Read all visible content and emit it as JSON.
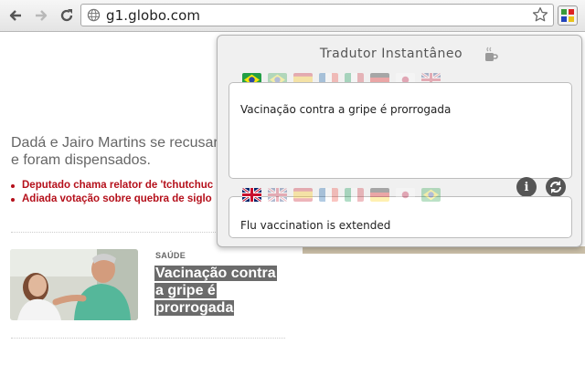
{
  "browser": {
    "url": "g1.globo.com",
    "icons": [
      "back-arrow-icon",
      "forward-arrow-icon",
      "reload-icon",
      "globe-icon",
      "bookmark-star-icon",
      "translator-extension-icon"
    ]
  },
  "page": {
    "lead_line1": "Dadá e Jairo Martins se recusara",
    "lead_line2": "e foram dispensados.",
    "bullets": [
      "Deputado chama relator de 'tchutchuc",
      "Adiada votação sobre quebra de siglo"
    ],
    "story": {
      "section": "SAÚDE",
      "headline": "Vacinação contra a gripe é prorrogada"
    },
    "colors": {
      "bullet_red": "#b5101b",
      "headline_bg": "#6b6b6b"
    }
  },
  "popup": {
    "title": "Tradutor Instantâneo",
    "source_flags": [
      {
        "name": "brazil-flag-icon",
        "active": true
      },
      {
        "name": "brazil-flag-icon",
        "active": false
      },
      {
        "name": "spain-flag-icon",
        "active": false
      },
      {
        "name": "france-flag-icon",
        "active": false
      },
      {
        "name": "italy-flag-icon",
        "active": false
      },
      {
        "name": "germany-flag-icon",
        "active": false
      },
      {
        "name": "japan-flag-icon",
        "active": false
      },
      {
        "name": "uk-flag-icon",
        "active": false
      }
    ],
    "target_flags": [
      {
        "name": "uk-flag-icon",
        "active": true
      },
      {
        "name": "uk-flag-icon",
        "active": false
      },
      {
        "name": "spain-flag-icon",
        "active": false
      },
      {
        "name": "france-flag-icon",
        "active": false
      },
      {
        "name": "italy-flag-icon",
        "active": false
      },
      {
        "name": "germany-flag-icon",
        "active": false
      },
      {
        "name": "japan-flag-icon",
        "active": false
      },
      {
        "name": "brazil-flag-icon",
        "active": false
      }
    ],
    "source_text": "Vacinação contra a gripe é prorrogada",
    "translated_text": "Flu vaccination is extended",
    "info_button": "i"
  }
}
